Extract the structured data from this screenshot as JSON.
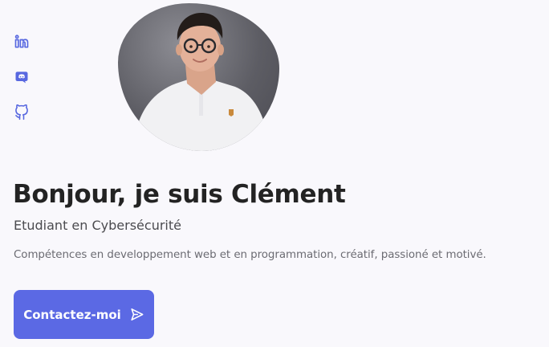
{
  "social": {
    "links": [
      {
        "name": "linkedin",
        "icon": "linkedin-icon"
      },
      {
        "name": "discord",
        "icon": "discord-icon"
      },
      {
        "name": "github",
        "icon": "github-icon"
      }
    ]
  },
  "hero": {
    "title": "Bonjour, je suis Clément",
    "subtitle": "Etudiant en Cybersécurité",
    "description": "Compétences en developpement web et en programmation, créatif, passioné et motivé.",
    "cta_label": "Contactez-moi",
    "cta_icon": "send-icon"
  },
  "colors": {
    "accent": "#5b69e4",
    "background": "#f9f8fc",
    "title": "#232323",
    "subtitle": "#4b4b4f",
    "text": "#6b6b72"
  }
}
